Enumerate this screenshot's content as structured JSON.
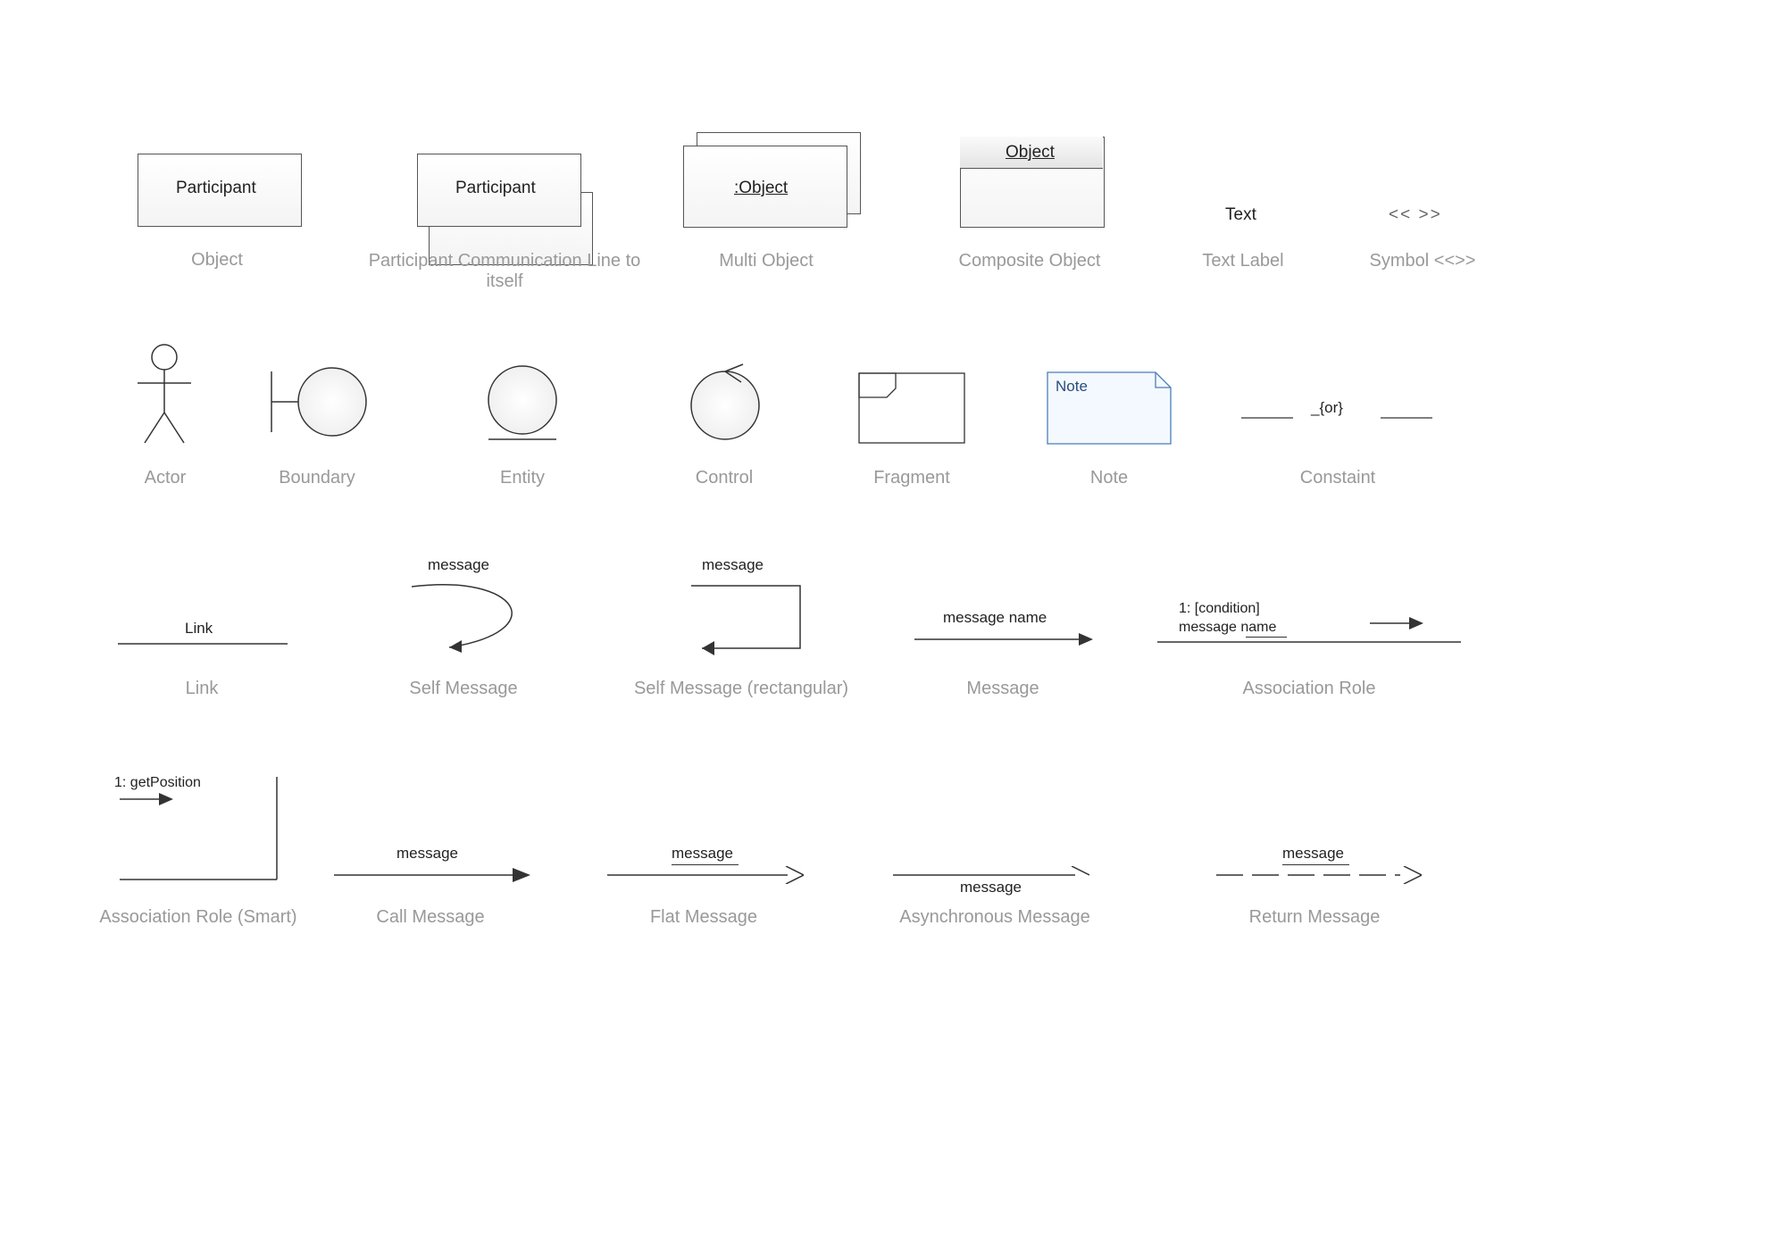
{
  "row1": {
    "object": {
      "text": "Participant",
      "caption": "Object"
    },
    "pcomm": {
      "text": "Participant",
      "caption": "Participant Communication Line to itself"
    },
    "multi": {
      "text": ":Object",
      "caption": "Multi Object"
    },
    "comp": {
      "text": "Object",
      "caption": "Composite Object"
    },
    "tlabel": {
      "text": "Text",
      "caption": "Text Label"
    },
    "symbol": {
      "text": "<<  >>",
      "caption": "Symbol <<>>"
    }
  },
  "row2": {
    "actor": {
      "caption": "Actor"
    },
    "boundary": {
      "caption": "Boundary"
    },
    "entity": {
      "caption": "Entity"
    },
    "control": {
      "caption": "Control"
    },
    "fragment": {
      "caption": "Fragment"
    },
    "note": {
      "text": "Note",
      "caption": "Note"
    },
    "constraint": {
      "text": "_{or}",
      "caption": "Constaint"
    }
  },
  "row3": {
    "link": {
      "text": "Link",
      "caption": "Link"
    },
    "selfmsg": {
      "text": "message",
      "caption": "Self Message"
    },
    "selfrect": {
      "text": "message",
      "caption": "Self Message (rectangular)"
    },
    "message": {
      "text": "message name",
      "caption": "Message"
    },
    "assoc": {
      "line1": "1: [condition]",
      "line2": "message name",
      "caption": "Association Role"
    }
  },
  "row4": {
    "assocsmart": {
      "text": "1: getPosition",
      "caption": "Association Role (Smart)"
    },
    "callmsg": {
      "text": "message",
      "caption": "Call Message"
    },
    "flatmsg": {
      "text": "message",
      "caption": "Flat Message"
    },
    "asyncmsg": {
      "text": "message",
      "caption": "Asynchronous Message"
    },
    "retmsg": {
      "text": "message",
      "caption": "Return Message"
    }
  }
}
